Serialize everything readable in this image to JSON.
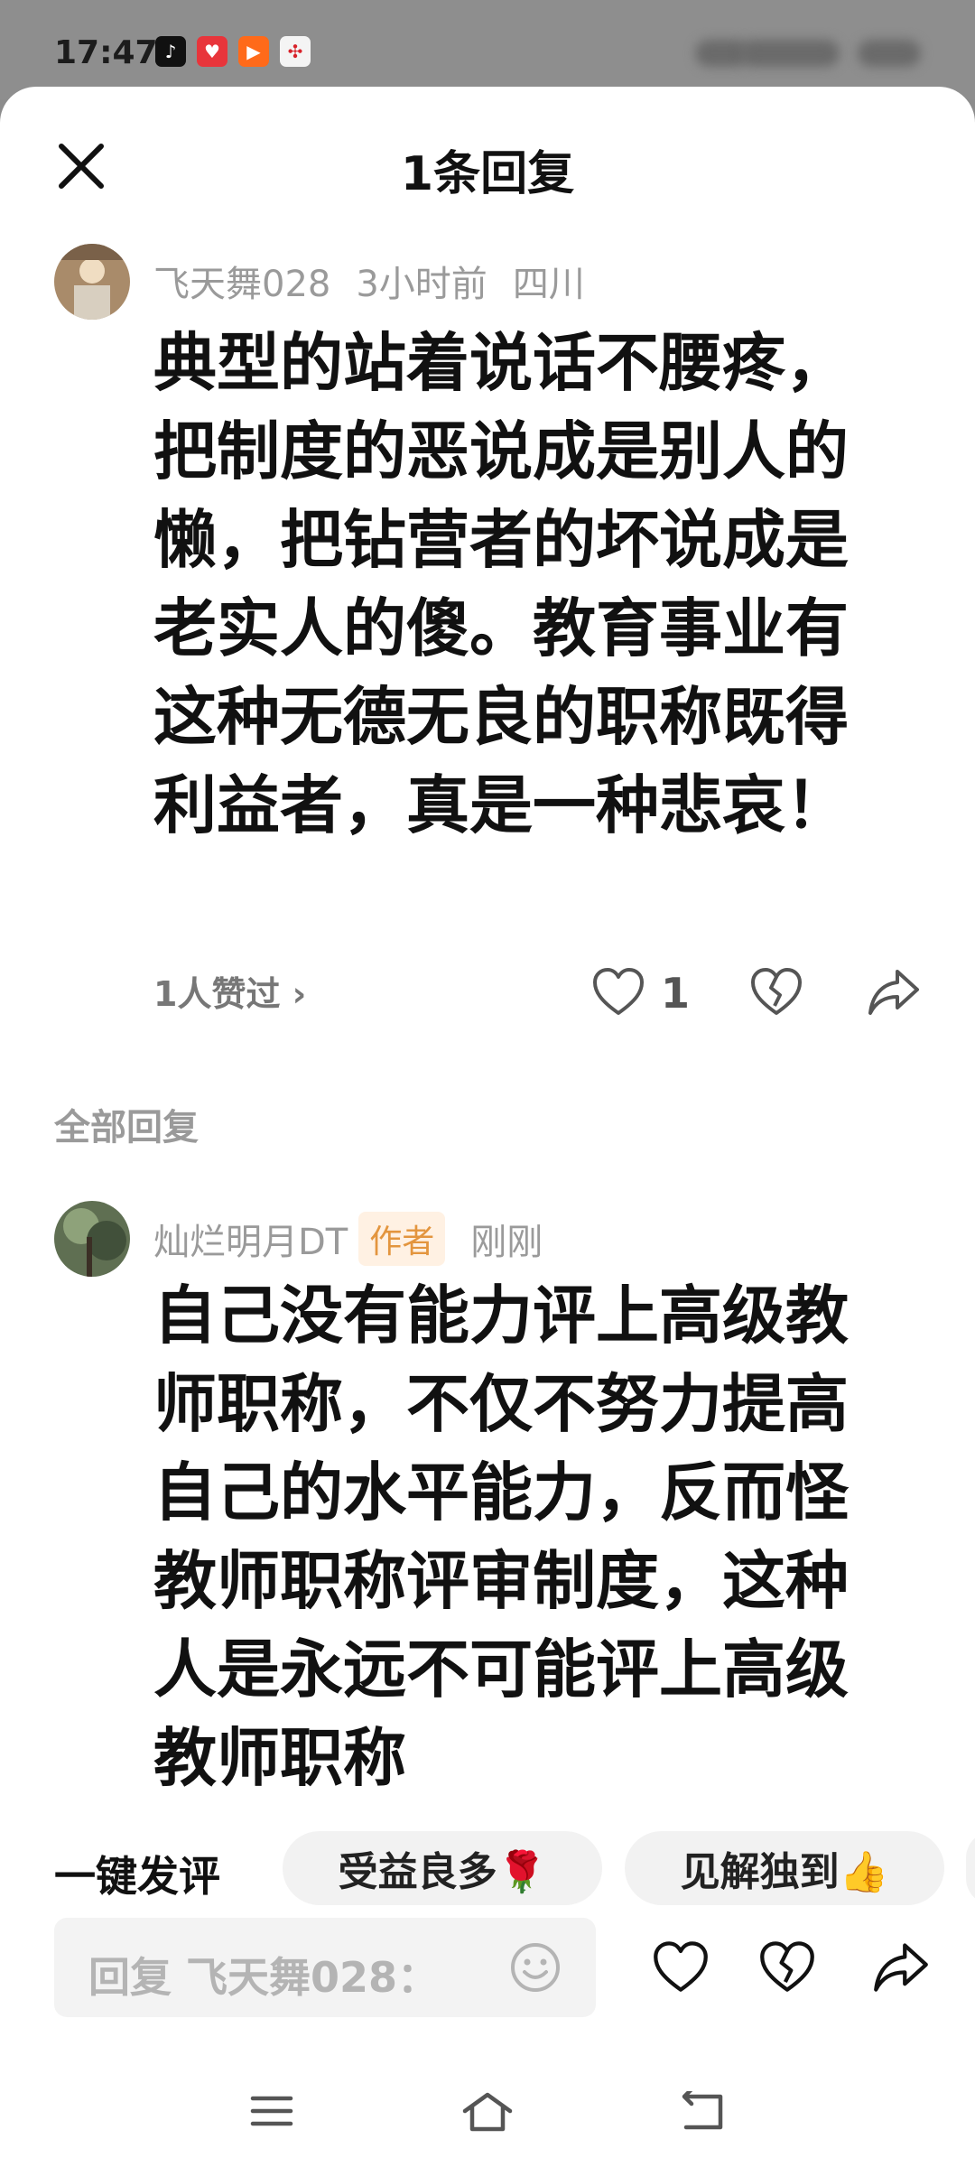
{
  "status_bar": {
    "time": "17:47",
    "app_icons": [
      "tiktok-icon",
      "red-heart-app-icon",
      "kuaishou-icon",
      "china-unicom-icon"
    ]
  },
  "header": {
    "title": "1条回复"
  },
  "top_comment": {
    "username": "飞天舞028",
    "time": "3小时前",
    "location": "四川",
    "text": "典型的站着说话不腰疼，把制度的恶说成是别人的懒，把钻营者的坏说成是老实人的傻。教育事业有这种无德无良的职称既得利益者，真是一种悲哀！",
    "likes_summary": "1人赞过 ›",
    "like_count": "1"
  },
  "replies_section": {
    "label": "全部回复"
  },
  "reply": {
    "username": "灿烂明月DT",
    "badge": "作者",
    "time": "刚刚",
    "text": "自己没有能力评上高级教师职称，不仅不努力提高自己的水平能力，反而怪教师职称评审制度，这种人是永远不可能评上高级教师职称"
  },
  "quick_reply": {
    "label": "一键发评",
    "chips": [
      "受益良多🌹",
      "见解独到👍"
    ]
  },
  "reply_input": {
    "placeholder": "回复 飞天舞028："
  },
  "colors": {
    "accent_badge_bg": "#fff1e3",
    "accent_badge_text": "#e3953e",
    "muted_text": "#9a9a9a"
  }
}
